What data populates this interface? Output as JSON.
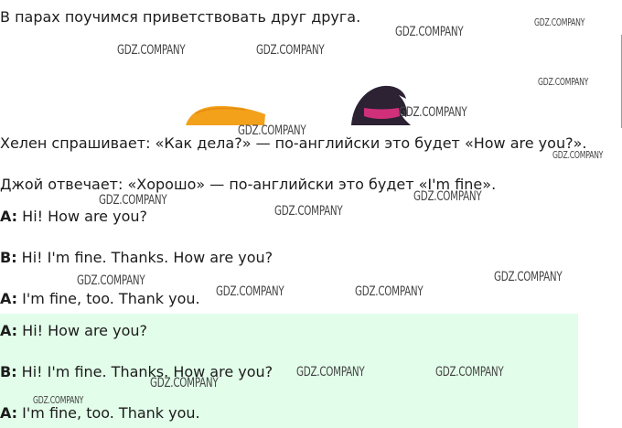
{
  "intro": "В парах поучимся приветствовать друг друга.",
  "helen_line": "Хелен спрашивает: «Как дела?» — по-английски это будет «How are you?».",
  "joy_line": "Джой отвечает: «Хорошо» — по-английски это будет «I'm fine».",
  "dialogue_plain": [
    {
      "speaker": "A:",
      "text": " Hi! How are you?"
    },
    {
      "speaker": "B:",
      "text": " Hi! I'm fine. Thanks. How are you?"
    },
    {
      "speaker": "A:",
      "text": " I'm fine, too. Thank you."
    }
  ],
  "dialogue_green": [
    {
      "speaker": "A:",
      "text": " Hi! How are you?"
    },
    {
      "speaker": "B:",
      "text": " Hi! I'm fine. Thanks. How are you?"
    },
    {
      "speaker": "A:",
      "text": " I'm fine, too. Thank you."
    }
  ],
  "watermark": "GDZ.COMPANY",
  "colors": {
    "highlight": "#e2fde9",
    "hair_orange": "#f3a01b",
    "hair_dark": "#2c2233",
    "scarf_pink": "#d0307a"
  }
}
